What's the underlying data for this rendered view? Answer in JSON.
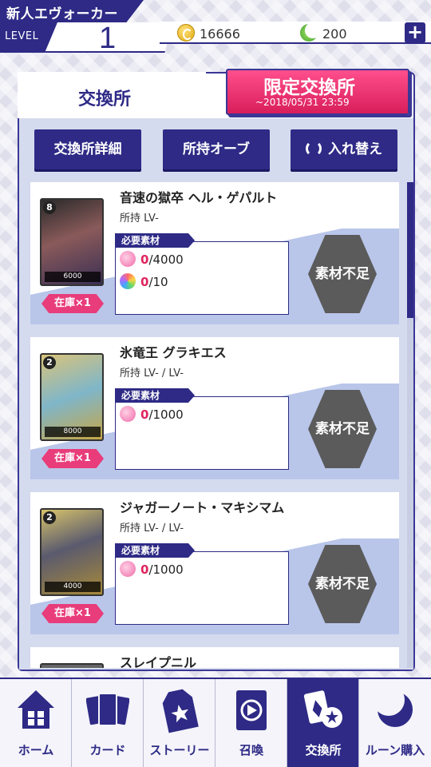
{
  "header": {
    "player_name": "新人エヴォーカー",
    "level_label": "LEVEL",
    "level_value": "1",
    "coins": "16666",
    "moon_stones": "200"
  },
  "tabs": {
    "exchange": "交換所",
    "limited": "限定交換所",
    "limited_deadline": "~2018/05/31 23:59"
  },
  "toolbar": {
    "details": "交換所詳細",
    "owned_orbs": "所持オーブ",
    "sort": "入れ替え"
  },
  "entries": [
    {
      "name": "音速の獄卒 ヘル・ゲパルト",
      "owned": "所持 LV-",
      "cost": "8",
      "power": "6000",
      "stock": "在庫×1",
      "required_label": "必要素材",
      "materials": [
        {
          "icon": "pink-orb-icon",
          "have": "0",
          "need": "/4000"
        },
        {
          "icon": "rainbow-orb-icon",
          "have": "0",
          "need": "/10"
        }
      ],
      "status": "素材不足"
    },
    {
      "name": "氷竜王 グラキエス",
      "owned": "所持 LV- / LV-",
      "cost": "2",
      "power": "8000",
      "stock": "在庫×1",
      "required_label": "必要素材",
      "materials": [
        {
          "icon": "pink-orb-icon",
          "have": "0",
          "need": "/1000"
        }
      ],
      "status": "素材不足"
    },
    {
      "name": "ジャガーノート・マキシマム",
      "owned": "所持 LV- / LV-",
      "cost": "2",
      "power": "4000",
      "stock": "在庫×1",
      "required_label": "必要素材",
      "materials": [
        {
          "icon": "pink-orb-icon",
          "have": "0",
          "need": "/1000"
        }
      ],
      "status": "素材不足"
    },
    {
      "name": "スレイプニル"
    }
  ],
  "nav": [
    {
      "label": "ホーム",
      "icon": "home-icon"
    },
    {
      "label": "カード",
      "icon": "cards-icon"
    },
    {
      "label": "ストーリー",
      "icon": "story-tag-icon"
    },
    {
      "label": "召喚",
      "icon": "summon-book-icon"
    },
    {
      "label": "交換所",
      "icon": "exchange-icon",
      "active": true
    },
    {
      "label": "ルーン購入",
      "icon": "moon-icon"
    }
  ],
  "colors": {
    "primary": "#2e2a86",
    "accent_pink": "#e83d7a",
    "shortage_gray": "#5b5b5b"
  }
}
